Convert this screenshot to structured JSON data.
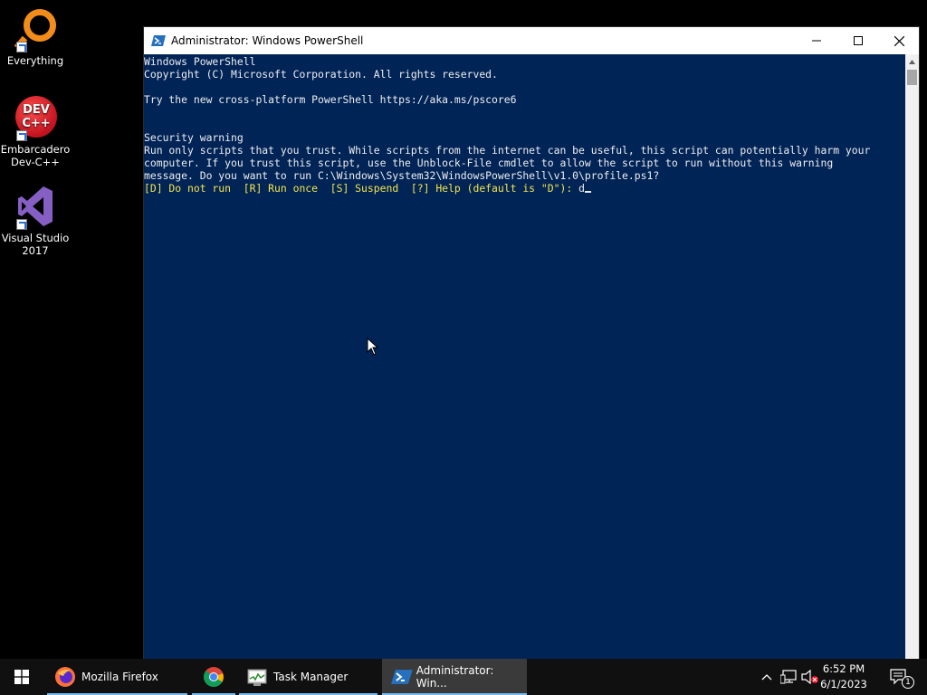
{
  "desktop": {
    "icons": [
      {
        "label": "Everything"
      },
      {
        "label_line1": "Embarcadero",
        "label_line2": "Dev-C++",
        "badge_line1": "DEV",
        "badge_line2": "C++"
      },
      {
        "label_line1": "Visual Studio",
        "label_line2": "2017"
      }
    ]
  },
  "window": {
    "title": "Administrator: Windows PowerShell",
    "icon": "powershell-icon"
  },
  "console": {
    "lines": [
      "Windows PowerShell",
      "Copyright (C) Microsoft Corporation. All rights reserved.",
      "",
      "Try the new cross-platform PowerShell https://aka.ms/pscore6",
      "",
      "",
      "Security warning",
      "Run only scripts that you trust. While scripts from the internet can be useful, this script can potentially harm your",
      "computer. If you trust this script, use the Unblock-File cmdlet to allow the script to run without this warning",
      "message. Do you want to run C:\\Windows\\System32\\WindowsPowerShell\\v1.0\\profile.ps1?"
    ],
    "prompt_option": "[D] Do not run",
    "prompt_rest": "  [R] Run once  [S] Suspend  [?] Help (default is \"D\"): ",
    "input": "d"
  },
  "taskbar": {
    "apps": [
      {
        "label": "Mozilla Firefox",
        "icon": "firefox-icon"
      },
      {
        "label": "",
        "icon": "chrome-icon"
      },
      {
        "label": "Task Manager",
        "icon": "task-manager-icon"
      },
      {
        "label": "Administrator: Win...",
        "icon": "powershell-icon",
        "active": true
      }
    ],
    "clock": {
      "time": "6:52 PM",
      "date": "6/1/2023"
    },
    "notification_count": "1"
  },
  "colors": {
    "console_bg": "#012456",
    "console_fg": "#eeedf0",
    "prompt_yellow": "#f5e44b",
    "taskbar_bg": "#101010",
    "accent": "#76b9ed"
  }
}
